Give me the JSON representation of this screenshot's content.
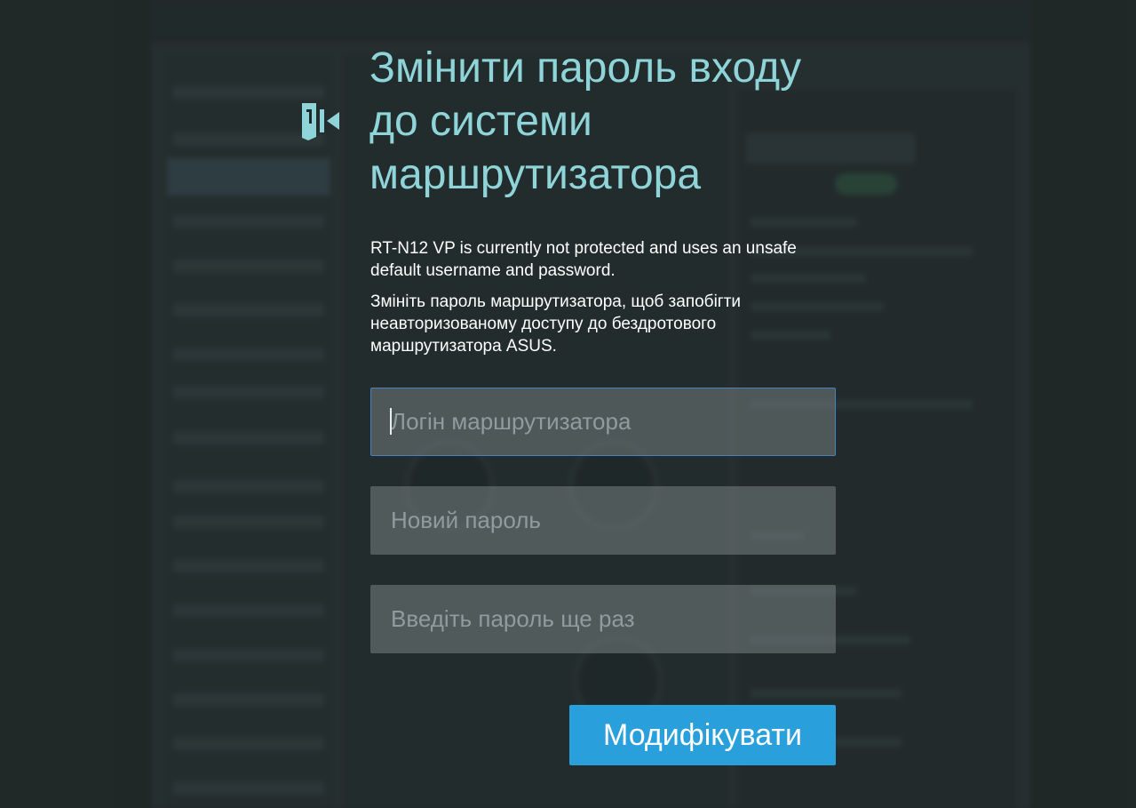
{
  "dialog": {
    "title": "Змінити пароль входу до системи маршрутизатора",
    "warning": "RT-N12 VP is currently not protected and uses an unsafe default username and password.",
    "advice": "Змініть пароль маршрутизатора, щоб запобігти неавторизованому доступу до бездротового маршрутизатора ASUS.",
    "icon": "door-icon",
    "accent_color": "#8fd4d8"
  },
  "form": {
    "login_placeholder": "Логін маршрутизатора",
    "login_value": "",
    "password_placeholder": "Новий пароль",
    "password_value": "",
    "confirm_placeholder": "Введіть пароль ще раз",
    "confirm_value": "",
    "submit_label": "Модифікувати",
    "submit_color": "#29a0dc"
  }
}
